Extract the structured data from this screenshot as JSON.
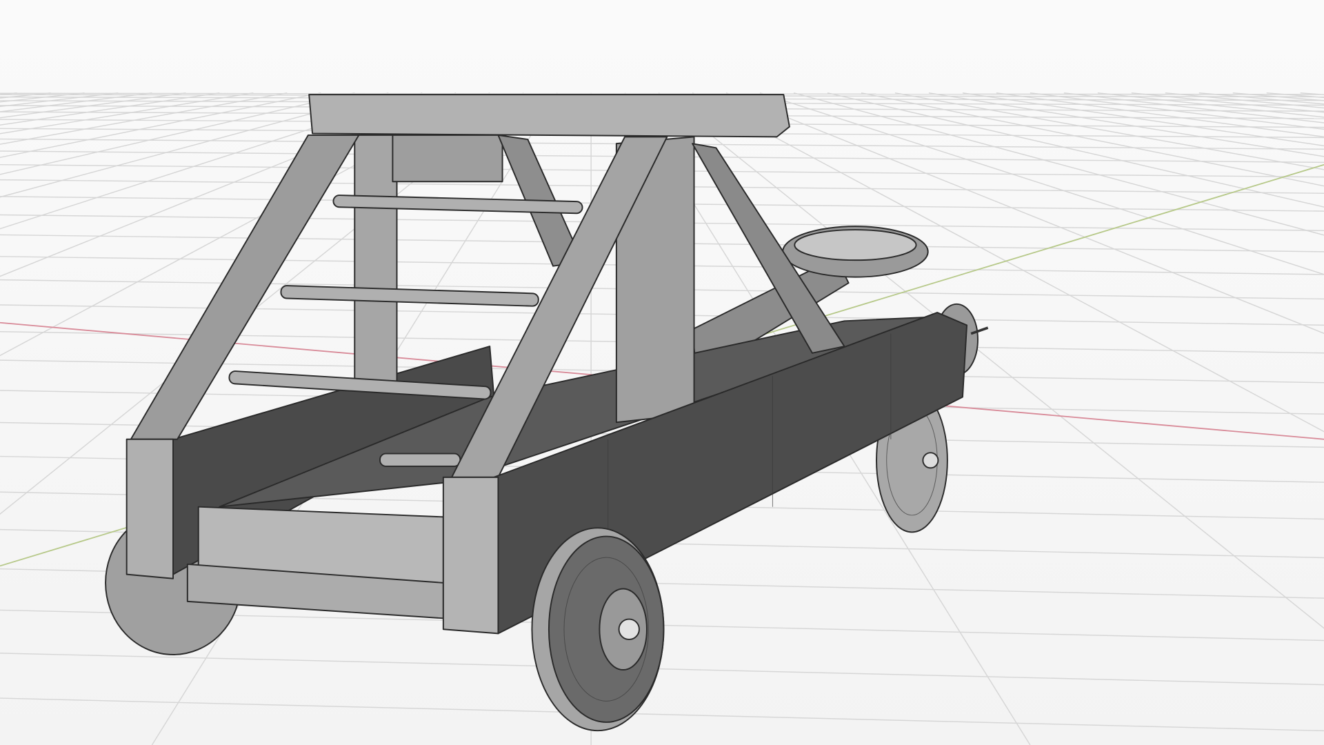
{
  "scene": {
    "object": "catapult",
    "colors": {
      "background": "#f7f7f7",
      "grid": "#d6d6d6",
      "x_axis": "#d88a98",
      "y_axis": "#b7c98a",
      "light_face": "#b4b4b4",
      "mid_face": "#8a8a8a",
      "dark_face": "#4a4a4a",
      "edge": "#2a2a2a"
    }
  }
}
